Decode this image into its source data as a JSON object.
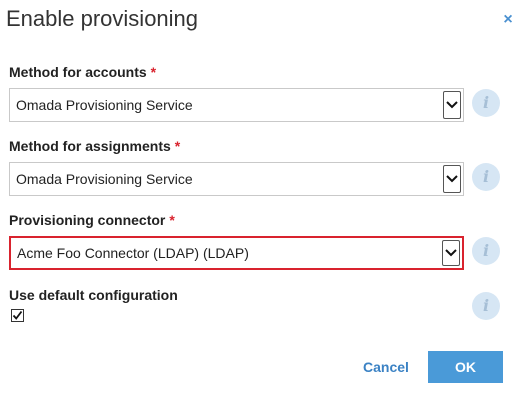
{
  "dialog": {
    "title": "Enable provisioning",
    "close_icon": "close-icon",
    "close_glyph": "×"
  },
  "fields": {
    "accounts": {
      "label": "Method for accounts",
      "required_mark": "*",
      "value": "Omada Provisioning Service",
      "info_glyph": "i"
    },
    "assignments": {
      "label": "Method for assignments",
      "required_mark": "*",
      "value": "Omada Provisioning Service",
      "info_glyph": "i"
    },
    "connector": {
      "label": "Provisioning connector",
      "required_mark": "*",
      "value": "Acme Foo Connector (LDAP) (LDAP)",
      "info_glyph": "i",
      "highlight_color": "#d9232e"
    },
    "default_config": {
      "label": "Use default configuration",
      "checked": true,
      "info_glyph": "i"
    }
  },
  "buttons": {
    "cancel": "Cancel",
    "ok": "OK"
  },
  "colors": {
    "accent": "#4a9ad8",
    "link": "#3b82c4",
    "required": "#d9232e",
    "info_bg": "#d6e6f4"
  }
}
